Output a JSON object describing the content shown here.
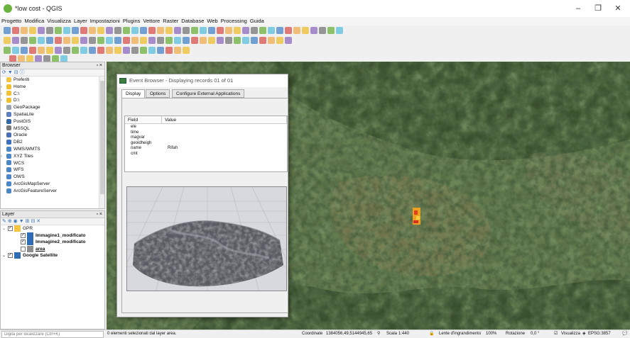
{
  "window": {
    "title": "*low cost - QGIS",
    "minimize": "–",
    "maximize": "❐",
    "close": "✕"
  },
  "menu": [
    "Progetto",
    "Modifica",
    "Visualizza",
    "Layer",
    "Impostazioni",
    "Plugins",
    "Vettore",
    "Raster",
    "Database",
    "Web",
    "Processing",
    "Guida"
  ],
  "browser": {
    "title": "Browser",
    "controls": "▫ ×",
    "items": [
      {
        "label": "Preferiti",
        "arrow": "",
        "color": "#f5c542"
      },
      {
        "label": "Home",
        "arrow": "›",
        "color": "#f0c030"
      },
      {
        "label": "C:\\",
        "arrow": "›",
        "color": "#f0c030"
      },
      {
        "label": "D:\\",
        "arrow": "›",
        "color": "#f0c030"
      },
      {
        "label": "GeoPackage",
        "arrow": "",
        "color": "#9aa4b0"
      },
      {
        "label": "SpatiaLite",
        "arrow": "",
        "color": "#5b7fbf"
      },
      {
        "label": "PostGIS",
        "arrow": "",
        "color": "#3465a4"
      },
      {
        "label": "MSSQL",
        "arrow": "",
        "color": "#7a7a7a"
      },
      {
        "label": "Oracle",
        "arrow": "",
        "color": "#4a6fb5"
      },
      {
        "label": "DB2",
        "arrow": "",
        "color": "#3c6fc0"
      },
      {
        "label": "WMS/WMTS",
        "arrow": "",
        "color": "#4a86c8"
      },
      {
        "label": "XYZ Tiles",
        "arrow": "›",
        "color": "#4a86c8"
      },
      {
        "label": "WCS",
        "arrow": "",
        "color": "#4a86c8"
      },
      {
        "label": "WFS",
        "arrow": "",
        "color": "#4a86c8"
      },
      {
        "label": "OWS",
        "arrow": "",
        "color": "#4a86c8"
      },
      {
        "label": "ArcGisMapServer",
        "arrow": "",
        "color": "#4a86c8"
      },
      {
        "label": "ArcGisFeatureServer",
        "arrow": "",
        "color": "#4a86c8"
      }
    ]
  },
  "layers": {
    "title": "Layer",
    "controls": "▫ ×",
    "items": [
      {
        "label": "GPR",
        "arrow": "⌄",
        "checked": "✓",
        "indent": 0,
        "color": "#f5c542",
        "bold": false
      },
      {
        "label": "Immagine1_modificato",
        "arrow": "",
        "checked": "✓",
        "indent": 1,
        "color": "#2e6db5",
        "bold": true
      },
      {
        "label": "Immagine2_modificato",
        "arrow": "",
        "checked": "✓",
        "indent": 1,
        "color": "#2e6db5",
        "bold": true
      },
      {
        "label": "area",
        "arrow": "",
        "checked": "",
        "indent": 1,
        "color": "#8c8c8c",
        "bold": true
      },
      {
        "label": "Google Satellite",
        "arrow": "⌄",
        "checked": "✓",
        "indent": 0,
        "color": "#2e6db5",
        "bold": true
      }
    ]
  },
  "event_browser": {
    "title": "Event Browser - Displaying records 01 of 01",
    "tabs": [
      "Display",
      "Options",
      "Configure External Applications"
    ],
    "columns": [
      "Field",
      "Value"
    ],
    "rows": [
      {
        "field": "ele",
        "value": ""
      },
      {
        "field": "time",
        "value": ""
      },
      {
        "field": "magvar",
        "value": ""
      },
      {
        "field": "geoidheigh",
        "value": ""
      },
      {
        "field": "name",
        "value": "Rifah"
      },
      {
        "field": "cmt",
        "value": ""
      }
    ]
  },
  "status": {
    "locator_placeholder": "Digita per localizzare (Ctrl+K)",
    "message": "0 elementi selezionati dal layer area.",
    "coord_label": "Coordinate",
    "coord_value": "1384056,49,5144945,65",
    "scale_label": "Scala",
    "scale_value": "1:440",
    "magnifier_label": "Lente d'ingrandimento",
    "magnifier_value": "100%",
    "rotation_label": "Rotazione",
    "rotation_value": "0,0 °",
    "render_label": "Visualizza",
    "crs": "EPSG:3857"
  },
  "colors": {
    "accent": "#3a74b8",
    "gpr_overlay": "#e87a1e"
  }
}
